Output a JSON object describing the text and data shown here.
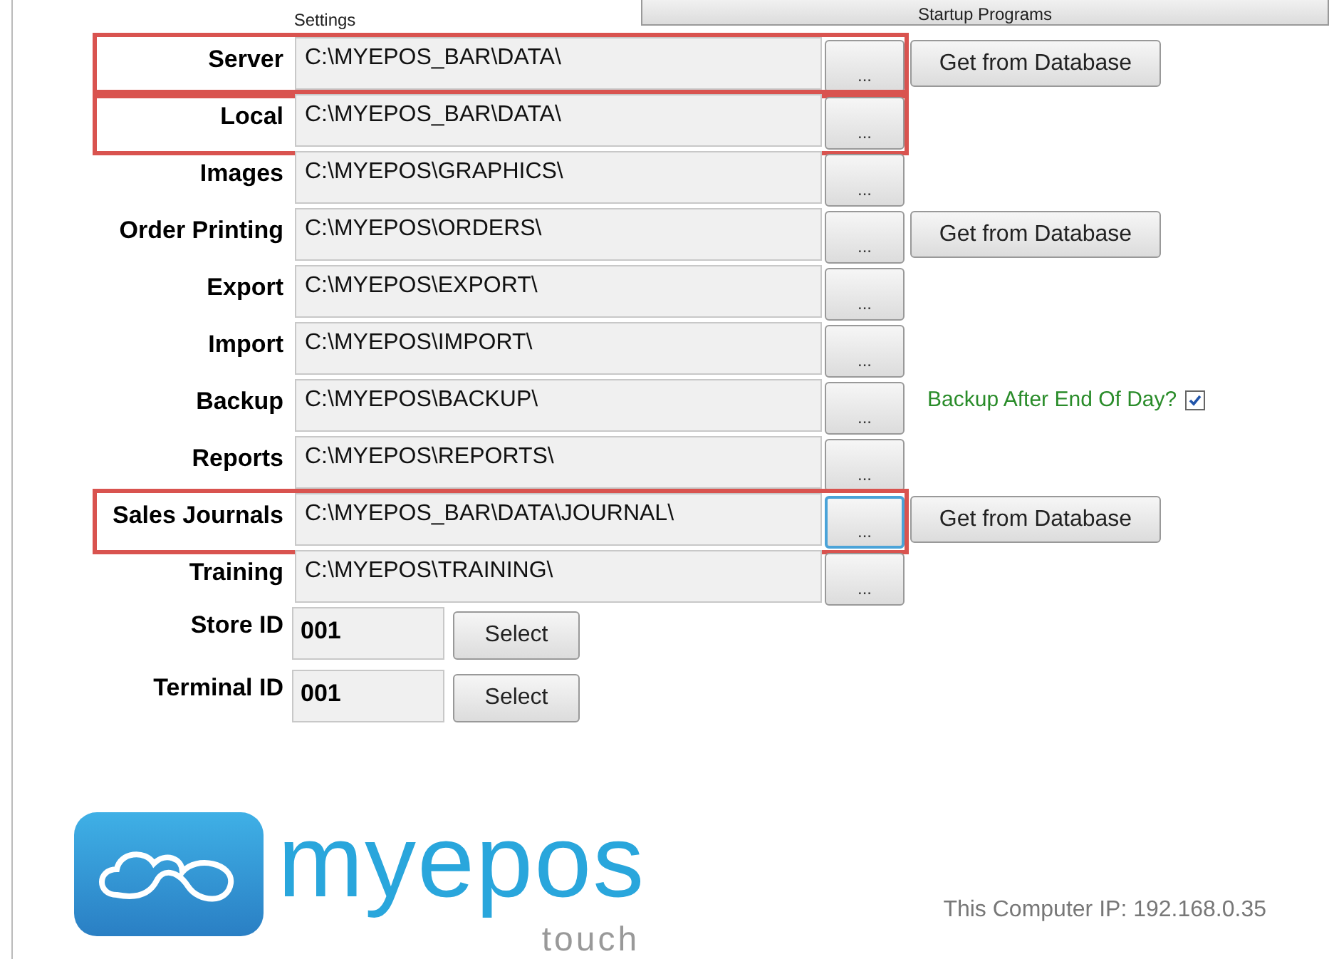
{
  "tabs": [
    {
      "label": "Settings",
      "selected": true
    },
    {
      "label": "Startup Programs",
      "selected": false
    }
  ],
  "paths": [
    {
      "label": "Server",
      "value": "C:\\MYEPOS_BAR\\DATA\\",
      "browse": "...",
      "extra": "Get from Database",
      "highlighted": true,
      "focused": false
    },
    {
      "label": "Local",
      "value": "C:\\MYEPOS_BAR\\DATA\\",
      "browse": "...",
      "highlighted": true,
      "focused": false
    },
    {
      "label": "Images",
      "value": "C:\\MYEPOS\\GRAPHICS\\",
      "browse": "...",
      "highlighted": false,
      "focused": false
    },
    {
      "label": "Order Printing",
      "value": "C:\\MYEPOS\\ORDERS\\",
      "browse": "...",
      "extra": "Get from Database",
      "highlighted": false,
      "focused": false
    },
    {
      "label": "Export",
      "value": "C:\\MYEPOS\\EXPORT\\",
      "browse": "...",
      "highlighted": false,
      "focused": false
    },
    {
      "label": "Import",
      "value": "C:\\MYEPOS\\IMPORT\\",
      "browse": "...",
      "highlighted": false,
      "focused": false
    },
    {
      "label": "Backup",
      "value": "C:\\MYEPOS\\BACKUP\\",
      "browse": "...",
      "option": {
        "label": "Backup After End Of Day?",
        "checked": true
      },
      "highlighted": false,
      "focused": false
    },
    {
      "label": "Reports",
      "value": "C:\\MYEPOS\\REPORTS\\",
      "browse": "...",
      "highlighted": false,
      "focused": false
    },
    {
      "label": "Sales Journals",
      "value": "C:\\MYEPOS_BAR\\DATA\\JOURNAL\\",
      "browse": "...",
      "extra": "Get from Database",
      "highlighted": true,
      "focused": true
    },
    {
      "label": "Training",
      "value": "C:\\MYEPOS\\TRAINING\\",
      "browse": "...",
      "highlighted": false,
      "focused": false
    }
  ],
  "ids": [
    {
      "label": "Store ID",
      "value": "001",
      "button": "Select"
    },
    {
      "label": "Terminal ID",
      "value": "001",
      "button": "Select"
    }
  ],
  "logo": {
    "name": "myepos",
    "tagline": "touch"
  },
  "ip_text": "This Computer IP: 192.168.0.35"
}
